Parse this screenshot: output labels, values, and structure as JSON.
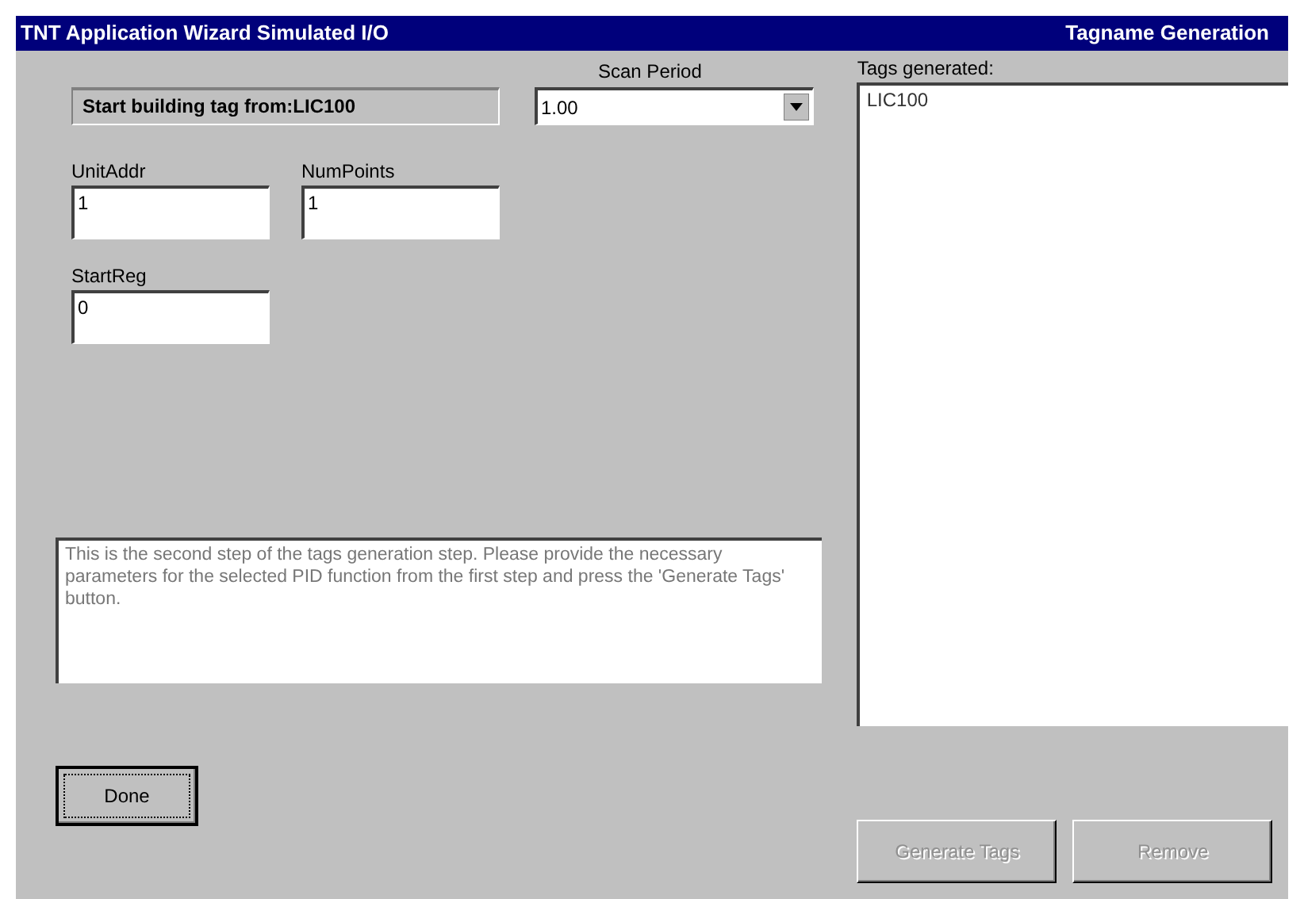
{
  "window": {
    "title": "TNT Application Wizard Simulated I/O",
    "section": "Tagname Generation"
  },
  "start_label": "Start building tag from:LIC100",
  "scan_period": {
    "label": "Scan Period",
    "value": "1.00"
  },
  "fields": [
    {
      "label": "UnitAddr",
      "value": "1"
    },
    {
      "label": "NumPoints",
      "value": "1"
    },
    {
      "label": "StartReg",
      "value": "0"
    }
  ],
  "description": "This is the second step of the tags generation step.  Please provide the necessary parameters for the selected PID function from the first step and press the 'Generate Tags' button.",
  "tags": {
    "label": "Tags generated:",
    "items": [
      "LIC100"
    ]
  },
  "done_button": {
    "label": "Done",
    "focused": true,
    "disabled": false
  },
  "buttons": [
    {
      "label": "Generate Tags",
      "focused": false,
      "disabled": true
    },
    {
      "label": "Remove",
      "focused": false,
      "disabled": true
    }
  ]
}
